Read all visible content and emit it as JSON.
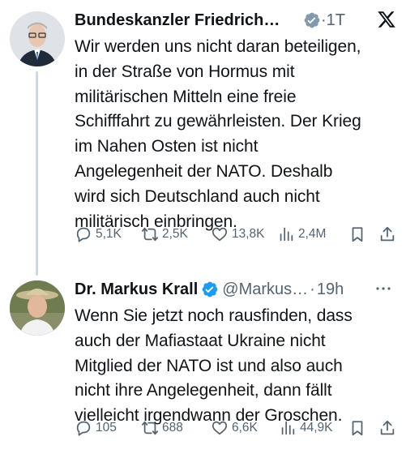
{
  "tweets": [
    {
      "display_name": "Bundeskanzler Friedrich…",
      "handle": "",
      "time": "·1T",
      "text": "Wir werden uns nicht daran beteiligen,\nin der Straße von Hormus mit\nmilitärischen Mitteln eine freie\nSchifffahrt zu gewährleisten. Der Krieg\nim Nahen Osten ist nicht\nAngelegenheit der NATO. Deshalb\nwird sich Deutschland auch nicht\nmilitärisch einbringen.",
      "verified_color": "#829aab",
      "replies": "5,1K",
      "retweets": "2,5K",
      "likes": "13,8K",
      "views": "2,4M"
    },
    {
      "display_name": "Dr. Markus Krall",
      "handle": "@Markus…",
      "time": "19h",
      "text": "Wenn Sie jetzt noch rausfinden, dass\nauch der Mafiastaat Ukraine nicht\nMitglied der NATO ist und also auch\nnicht ihre Angelegenheit, dann fällt\nvielleicht irgendwann der Groschen.",
      "verified_color": "#1d9bf0",
      "replies": "105",
      "retweets": "688",
      "likes": "6,6K",
      "views": "44,9K"
    }
  ],
  "icons": {
    "x_logo": "x-logo-icon",
    "more": "more-dots-icon"
  },
  "colors": {
    "text": "#0f1419",
    "secondary": "#536471",
    "thread_line": "#cfd9de",
    "blue_check": "#1d9bf0",
    "grey_check": "#829aab"
  }
}
